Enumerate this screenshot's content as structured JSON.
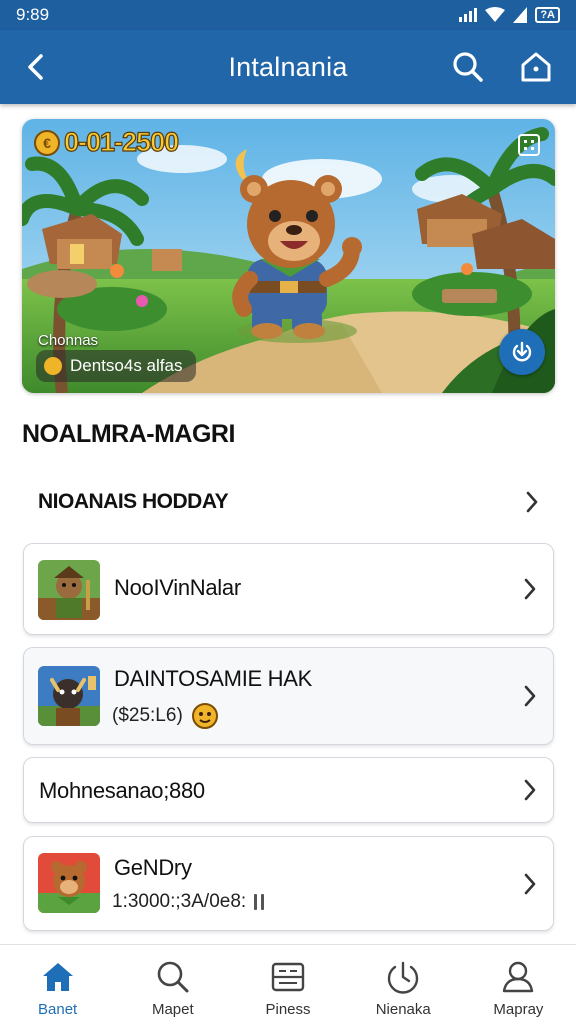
{
  "status": {
    "time": "9:89",
    "battery": "?A"
  },
  "appbar": {
    "title": "Intalnania",
    "colors": {
      "bar": "#2166a8",
      "status": "#1e5fa0"
    }
  },
  "hero": {
    "coins": "0-01-2500",
    "character_name": "Chonnas",
    "pill_label": "Dentso4s alfas"
  },
  "section": {
    "title": "NOALMRA-MAGRI"
  },
  "rows": [
    {
      "label": "NIOANAIS HODDAY"
    }
  ],
  "cards": [
    {
      "title": "NooIVinNalar",
      "subtitle": ""
    },
    {
      "title": "DAINTOSAMIE HAK",
      "subtitle": "($25:L6)"
    },
    {
      "title": "Mohnesanao;880",
      "subtitle": ""
    },
    {
      "title": "GeNDry",
      "subtitle": "1:3000:;3A/0e8:"
    }
  ],
  "nav": [
    {
      "label": "Banet",
      "icon": "home-icon",
      "active": true
    },
    {
      "label": "Mapet",
      "icon": "search-icon",
      "active": false
    },
    {
      "label": "Piness",
      "icon": "inbox-icon",
      "active": false
    },
    {
      "label": "Nienaka",
      "icon": "timer-icon",
      "active": false
    },
    {
      "label": "Mapray",
      "icon": "profile-icon",
      "active": false
    }
  ],
  "accent": "#1f6fb8"
}
